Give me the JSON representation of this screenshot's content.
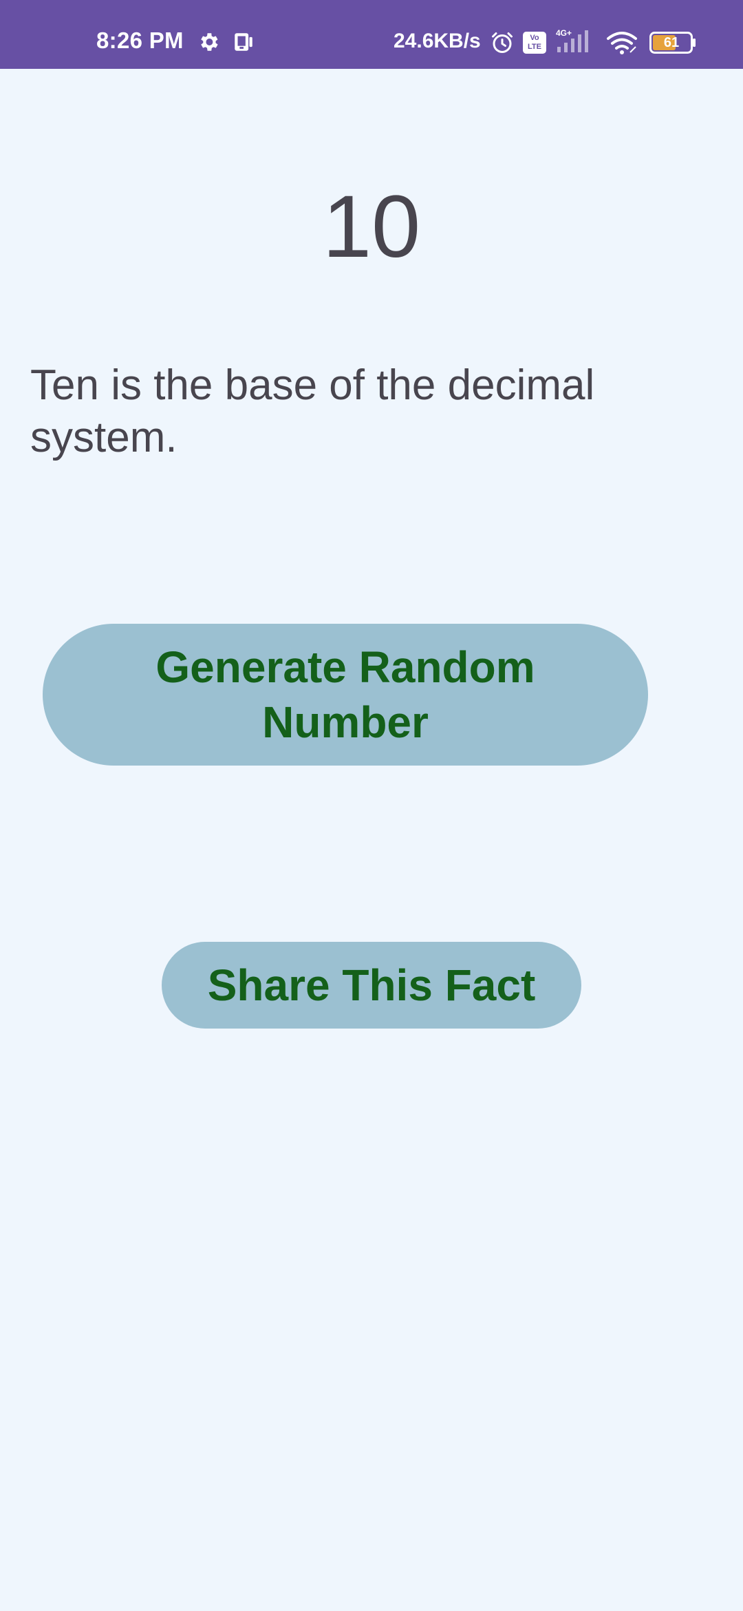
{
  "status_bar": {
    "time": "8:26 PM",
    "network_speed": "24.6KB/s",
    "volte_label": "Vo LTE",
    "network_type": "4G+",
    "battery_level": "61",
    "icons": [
      "gear-icon",
      "notification-icon",
      "alarm-icon",
      "volte-icon",
      "signal-icon",
      "wifi-icon",
      "battery-icon"
    ]
  },
  "main": {
    "number": "10",
    "fact": "Ten is the base of the decimal system.",
    "generate_button_label": "Generate Random Number",
    "share_button_label": "Share This Fact"
  },
  "colors": {
    "status_bar_bg": "#6750a4",
    "background": "#eff6fd",
    "button_bg": "#9bc0d1",
    "button_text": "#14601a",
    "text": "#48454e"
  }
}
